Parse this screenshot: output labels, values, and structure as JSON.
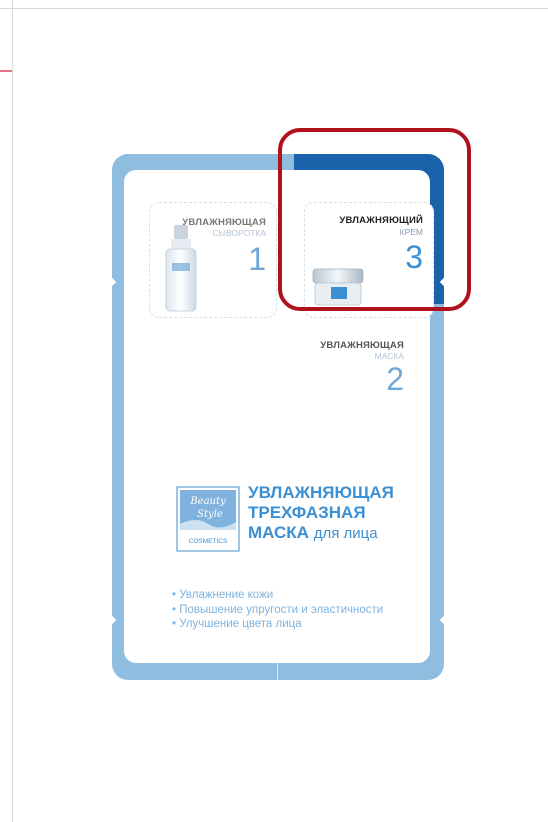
{
  "steps": [
    {
      "name": "УВЛАЖНЯЮЩАЯ",
      "sub": "СЫВОРОТКА",
      "number": "1"
    },
    {
      "name": "УВЛАЖНЯЮЩАЯ",
      "sub": "МАСКА",
      "number": "2"
    },
    {
      "name": "УВЛАЖНЯЮЩИЙ",
      "sub": "КРЕМ",
      "number": "3"
    }
  ],
  "brand": {
    "line1": "Beauty",
    "line2": "Style",
    "line3": "COSMETICS"
  },
  "headline": {
    "line1": "УВЛАЖНЯЮЩАЯ",
    "line2": "ТРЕХФАЗНАЯ",
    "line3_bold": "МАСКА",
    "line3_rest": "для лица"
  },
  "benefits": [
    "Увлажнение кожи",
    "Повышение упругости и эластичности",
    "Улучшение цвета лица"
  ],
  "colors": {
    "packet_light": "#8fbde0",
    "packet_dark": "#1a62aa",
    "accent_blue": "#3b8fd3",
    "highlight_red": "#b0121b"
  }
}
